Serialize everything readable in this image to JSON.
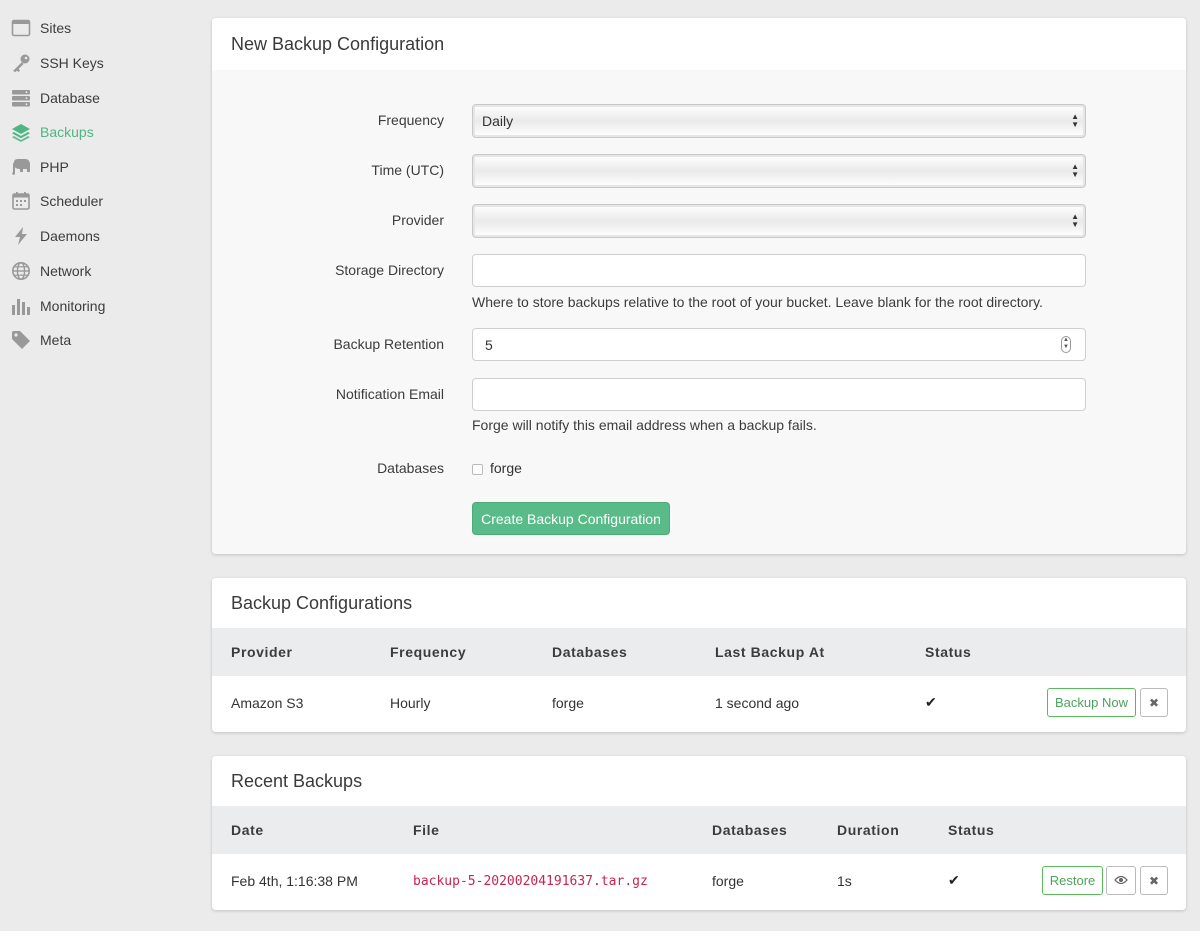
{
  "sidebar": {
    "items": [
      {
        "label": "Sites",
        "icon": "browser-window-icon"
      },
      {
        "label": "SSH Keys",
        "icon": "key-icon"
      },
      {
        "label": "Database",
        "icon": "database-icon"
      },
      {
        "label": "Backups",
        "icon": "layers-icon",
        "active": true
      },
      {
        "label": "PHP",
        "icon": "elephant-icon"
      },
      {
        "label": "Scheduler",
        "icon": "calendar-icon"
      },
      {
        "label": "Daemons",
        "icon": "lightning-icon"
      },
      {
        "label": "Network",
        "icon": "globe-icon"
      },
      {
        "label": "Monitoring",
        "icon": "bar-chart-icon"
      },
      {
        "label": "Meta",
        "icon": "tag-icon"
      }
    ],
    "active_color": "#4fb584"
  },
  "new_backup": {
    "title": "New Backup Configuration",
    "frequency_label": "Frequency",
    "frequency_value": "Daily",
    "time_label": "Time (UTC)",
    "time_value": "",
    "provider_label": "Provider",
    "provider_value": "",
    "storage_label": "Storage Directory",
    "storage_value": "",
    "storage_help": "Where to store backups relative to the root of your bucket. Leave blank for the root directory.",
    "retention_label": "Backup Retention",
    "retention_value": "5",
    "email_label": "Notification Email",
    "email_value": "",
    "email_help": "Forge will notify this email address when a backup fails.",
    "databases_label": "Databases",
    "database_option": "forge",
    "database_checked": false,
    "submit_label": "Create Backup Configuration"
  },
  "configurations": {
    "title": "Backup Configurations",
    "headers": [
      "Provider",
      "Frequency",
      "Databases",
      "Last Backup At",
      "Status"
    ],
    "rows": [
      {
        "provider": "Amazon S3",
        "frequency": "Hourly",
        "databases": "forge",
        "last_backup": "1 second ago",
        "status": "✔",
        "action": "Backup Now"
      }
    ]
  },
  "recent": {
    "title": "Recent Backups",
    "headers": [
      "Date",
      "File",
      "Databases",
      "Duration",
      "Status"
    ],
    "rows": [
      {
        "date": "Feb 4th, 1:16:38 PM",
        "file": "backup-5-20200204191637.tar.gz",
        "databases": "forge",
        "duration": "1s",
        "status": "✔",
        "action": "Restore"
      }
    ]
  },
  "colors": {
    "primary_green": "#59bb87",
    "file_pink": "#c7254e"
  }
}
